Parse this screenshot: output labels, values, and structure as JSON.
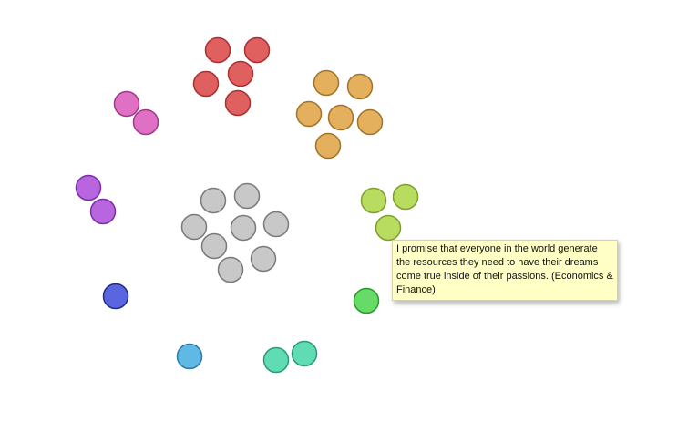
{
  "tooltip": {
    "text": "I promise that everyone in the world generate the resources they need to have their dreams come true inside of their passions. (Economics & Finance)"
  },
  "groups": [
    {
      "name": "red",
      "fill": "#e06060",
      "stroke": "#a83030",
      "count": 5
    },
    {
      "name": "orange",
      "fill": "#e4b05e",
      "stroke": "#a0752a",
      "count": 6
    },
    {
      "name": "pink",
      "fill": "#e070c4",
      "stroke": "#a03888",
      "count": 2
    },
    {
      "name": "purple",
      "fill": "#b866e0",
      "stroke": "#7a2ea6",
      "count": 2
    },
    {
      "name": "gray",
      "fill": "#c8c8c8",
      "stroke": "#7a7a7a",
      "count": 8
    },
    {
      "name": "lime",
      "fill": "#b8dc60",
      "stroke": "#7ea02a",
      "count": 3
    },
    {
      "name": "blue",
      "fill": "#5a66e0",
      "stroke": "#1e2a90",
      "count": 1
    },
    {
      "name": "green",
      "fill": "#66dc66",
      "stroke": "#2a9a2a",
      "count": 1
    },
    {
      "name": "skyblue",
      "fill": "#60b8e4",
      "stroke": "#2a7aa8",
      "count": 1
    },
    {
      "name": "teal",
      "fill": "#60dcb4",
      "stroke": "#2a9a78",
      "count": 2
    }
  ]
}
